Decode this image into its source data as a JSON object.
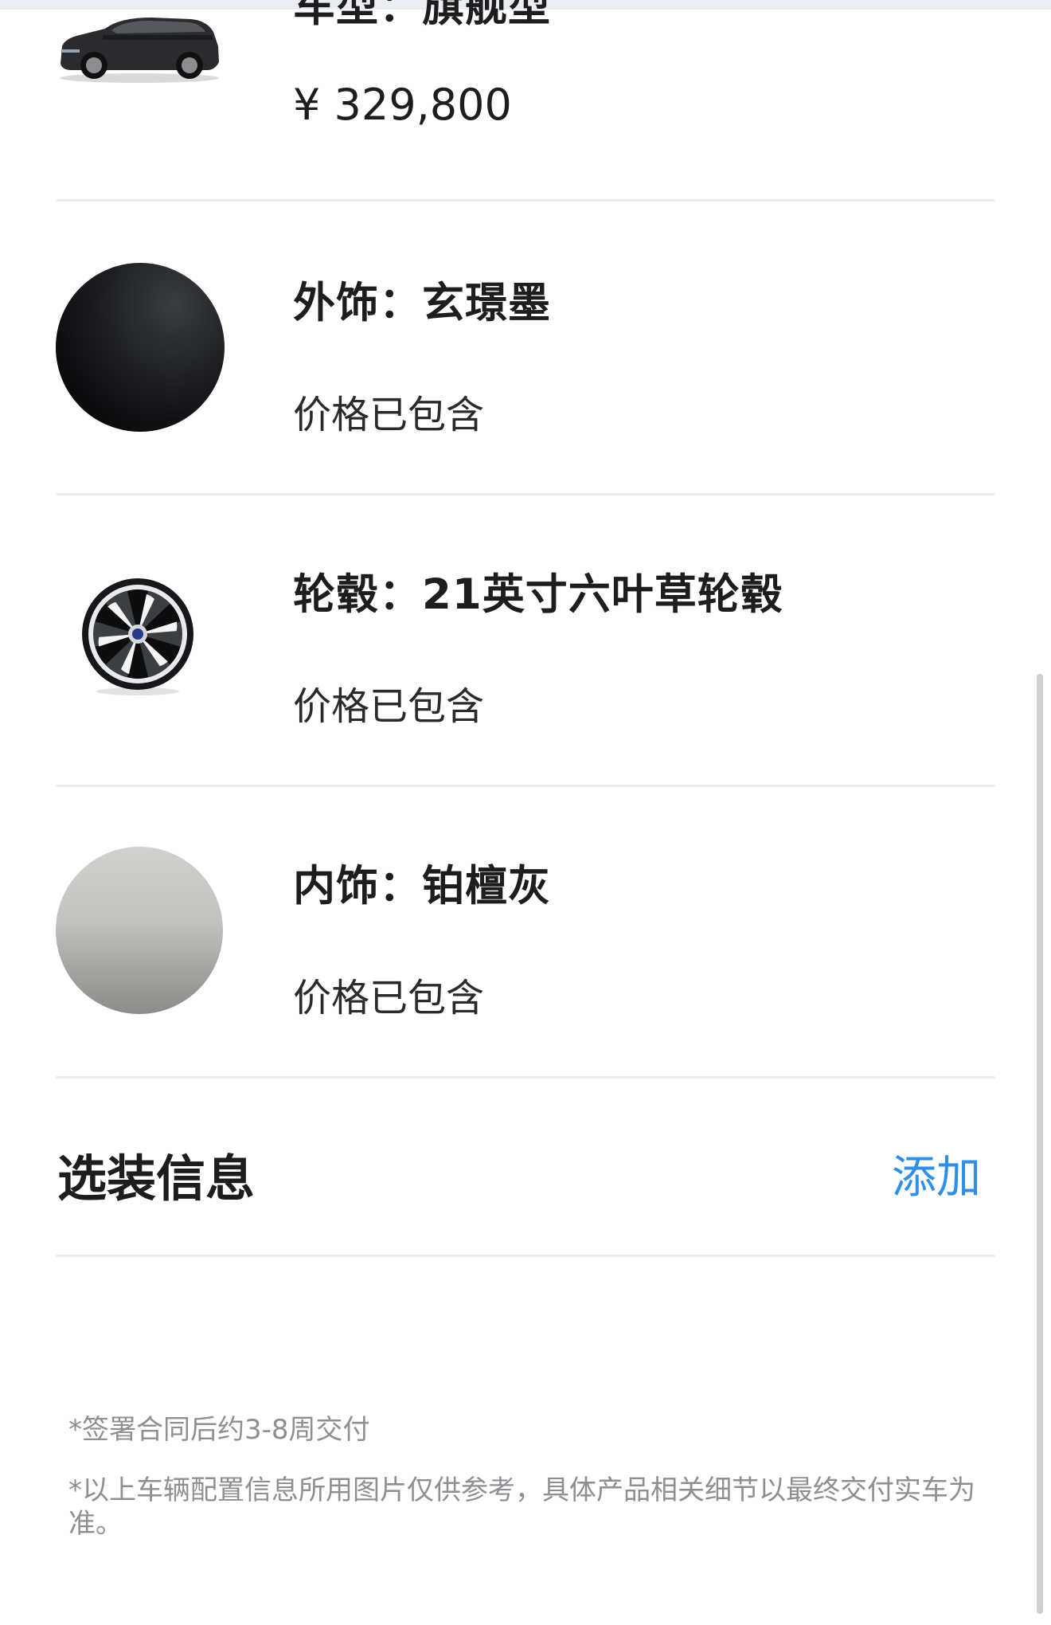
{
  "vehicle": {
    "title": "车型：旗舰型",
    "price": "¥ 329,800",
    "image_icon": "suv-car-icon"
  },
  "config_items": [
    {
      "title": "外饰：玄璟墨",
      "note": "价格已包含",
      "swatch": "#0d0e10"
    },
    {
      "title": "轮毂：21英寸六叶草轮毂",
      "note": "价格已包含",
      "image_icon": "wheel-rim-icon"
    },
    {
      "title": "内饰：铂檀灰",
      "note": "价格已包含",
      "swatch": "#b3b1ae"
    }
  ],
  "options": {
    "title": "选装信息",
    "add_label": "添加"
  },
  "footnotes": [
    "*签署合同后约3-8周交付",
    "*以上车辆配置信息所用图片仅供参考，具体产品相关细节以最终交付实车为准。"
  ],
  "colors": {
    "accent": "#2f8ee8",
    "text": "#1d1d1f",
    "muted": "#8e8e93",
    "divider": "#eeeeee"
  }
}
